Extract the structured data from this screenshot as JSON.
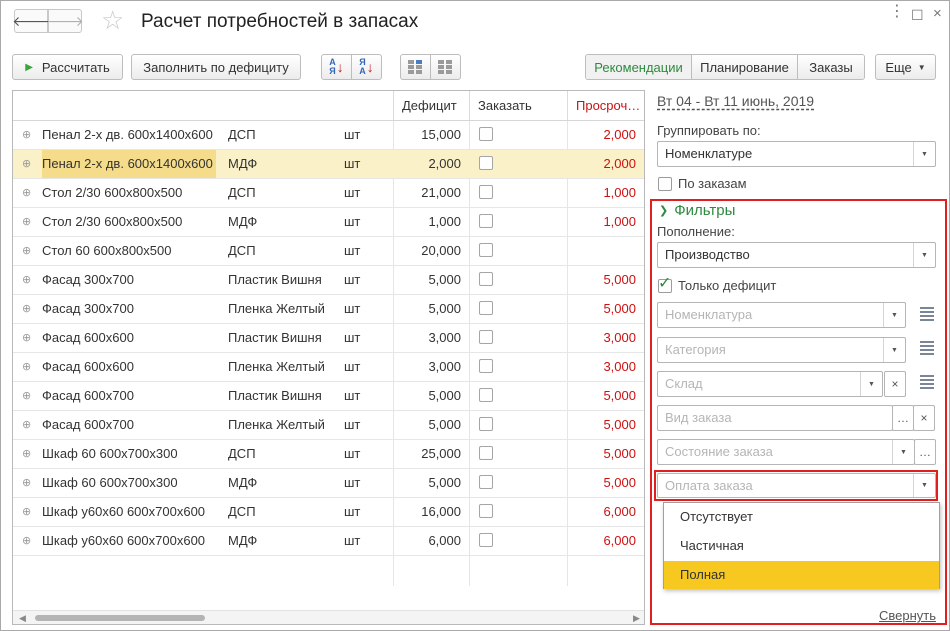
{
  "window": {
    "title": "Расчет потребностей в запасах",
    "controls": {
      "more": "⋮",
      "maximize": "☐",
      "close": "×"
    }
  },
  "nav": {
    "back": "🡐",
    "forward": "🡒",
    "favorite": "☆"
  },
  "toolbar": {
    "calculate_label": "Рассчитать",
    "fill_label": "Заполнить по дефициту",
    "tabs": [
      {
        "label": "Рекомендации",
        "active": true
      },
      {
        "label": "Планирование",
        "active": false
      },
      {
        "label": "Заказы",
        "active": false
      }
    ],
    "more_label": "Еще",
    "more_caret": "▼"
  },
  "table": {
    "columns": [
      "",
      "",
      "",
      "Дефицит",
      "Заказать",
      "Просроч…"
    ],
    "expand_glyph": "⊕",
    "rows": [
      {
        "name": "Пенал 2-х дв. 600х1400х600",
        "material": "ДСП",
        "unit": "шт",
        "deficit": "15,000",
        "overdue": "2,000",
        "selected": false
      },
      {
        "name": "Пенал 2-х дв. 600х1400х600",
        "material": "МДФ",
        "unit": "шт",
        "deficit": "2,000",
        "overdue": "2,000",
        "selected": true
      },
      {
        "name": "Стол 2/30 600х800х500",
        "material": "ДСП",
        "unit": "шт",
        "deficit": "21,000",
        "overdue": "1,000",
        "selected": false
      },
      {
        "name": "Стол 2/30 600х800х500",
        "material": "МДФ",
        "unit": "шт",
        "deficit": "1,000",
        "overdue": "1,000",
        "selected": false
      },
      {
        "name": "Стол 60 600х800х500",
        "material": "ДСП",
        "unit": "шт",
        "deficit": "20,000",
        "overdue": "",
        "selected": false
      },
      {
        "name": "Фасад 300х700",
        "material": "Пластик Вишня",
        "unit": "шт",
        "deficit": "5,000",
        "overdue": "5,000",
        "selected": false
      },
      {
        "name": "Фасад 300х700",
        "material": "Пленка Желтый",
        "unit": "шт",
        "deficit": "5,000",
        "overdue": "5,000",
        "selected": false
      },
      {
        "name": "Фасад 600х600",
        "material": "Пластик Вишня",
        "unit": "шт",
        "deficit": "3,000",
        "overdue": "3,000",
        "selected": false
      },
      {
        "name": "Фасад 600х600",
        "material": "Пленка Желтый",
        "unit": "шт",
        "deficit": "3,000",
        "overdue": "3,000",
        "selected": false
      },
      {
        "name": "Фасад 600х700",
        "material": "Пластик Вишня",
        "unit": "шт",
        "deficit": "5,000",
        "overdue": "5,000",
        "selected": false
      },
      {
        "name": "Фасад 600х700",
        "material": "Пленка Желтый",
        "unit": "шт",
        "deficit": "5,000",
        "overdue": "5,000",
        "selected": false
      },
      {
        "name": "Шкаф 60 600х700х300",
        "material": "ДСП",
        "unit": "шт",
        "deficit": "25,000",
        "overdue": "5,000",
        "selected": false
      },
      {
        "name": "Шкаф 60 600х700х300",
        "material": "МДФ",
        "unit": "шт",
        "deficit": "5,000",
        "overdue": "5,000",
        "selected": false
      },
      {
        "name": "Шкаф у60х60 600х700х600",
        "material": "ДСП",
        "unit": "шт",
        "deficit": "16,000",
        "overdue": "6,000",
        "selected": false
      },
      {
        "name": "Шкаф у60х60 600х700х600",
        "material": "МДФ",
        "unit": "шт",
        "deficit": "6,000",
        "overdue": "6,000",
        "selected": false
      }
    ]
  },
  "panel": {
    "period": "Вт 04 - Вт 11 июнь, 2019",
    "group_by_label": "Группировать по:",
    "group_by_value": "Номенклатуре",
    "by_orders_label": "По заказам",
    "by_orders_checked": false,
    "filters": {
      "title": "Фильтры",
      "replenishment_label": "Пополнение:",
      "replenishment_value": "Производство",
      "only_deficit_label": "Только дефицит",
      "only_deficit_checked": true,
      "nomenclature_placeholder": "Номенклатура",
      "category_placeholder": "Категория",
      "warehouse_placeholder": "Склад",
      "order_type_placeholder": "Вид заказа",
      "order_state_placeholder": "Состояние заказа",
      "payment_placeholder": "Оплата заказа",
      "payment_options": [
        "Отсутствует",
        "Частичная",
        "Полная"
      ],
      "payment_highlighted": "Полная"
    },
    "collapse_label": "Свернуть"
  },
  "colors": {
    "accent_green": "#2d8a3e",
    "overdue_red": "#cc1111",
    "highlight_border": "#e02020",
    "selected_row": "#fbf1c8",
    "dropdown_highlight": "#f6c820"
  }
}
